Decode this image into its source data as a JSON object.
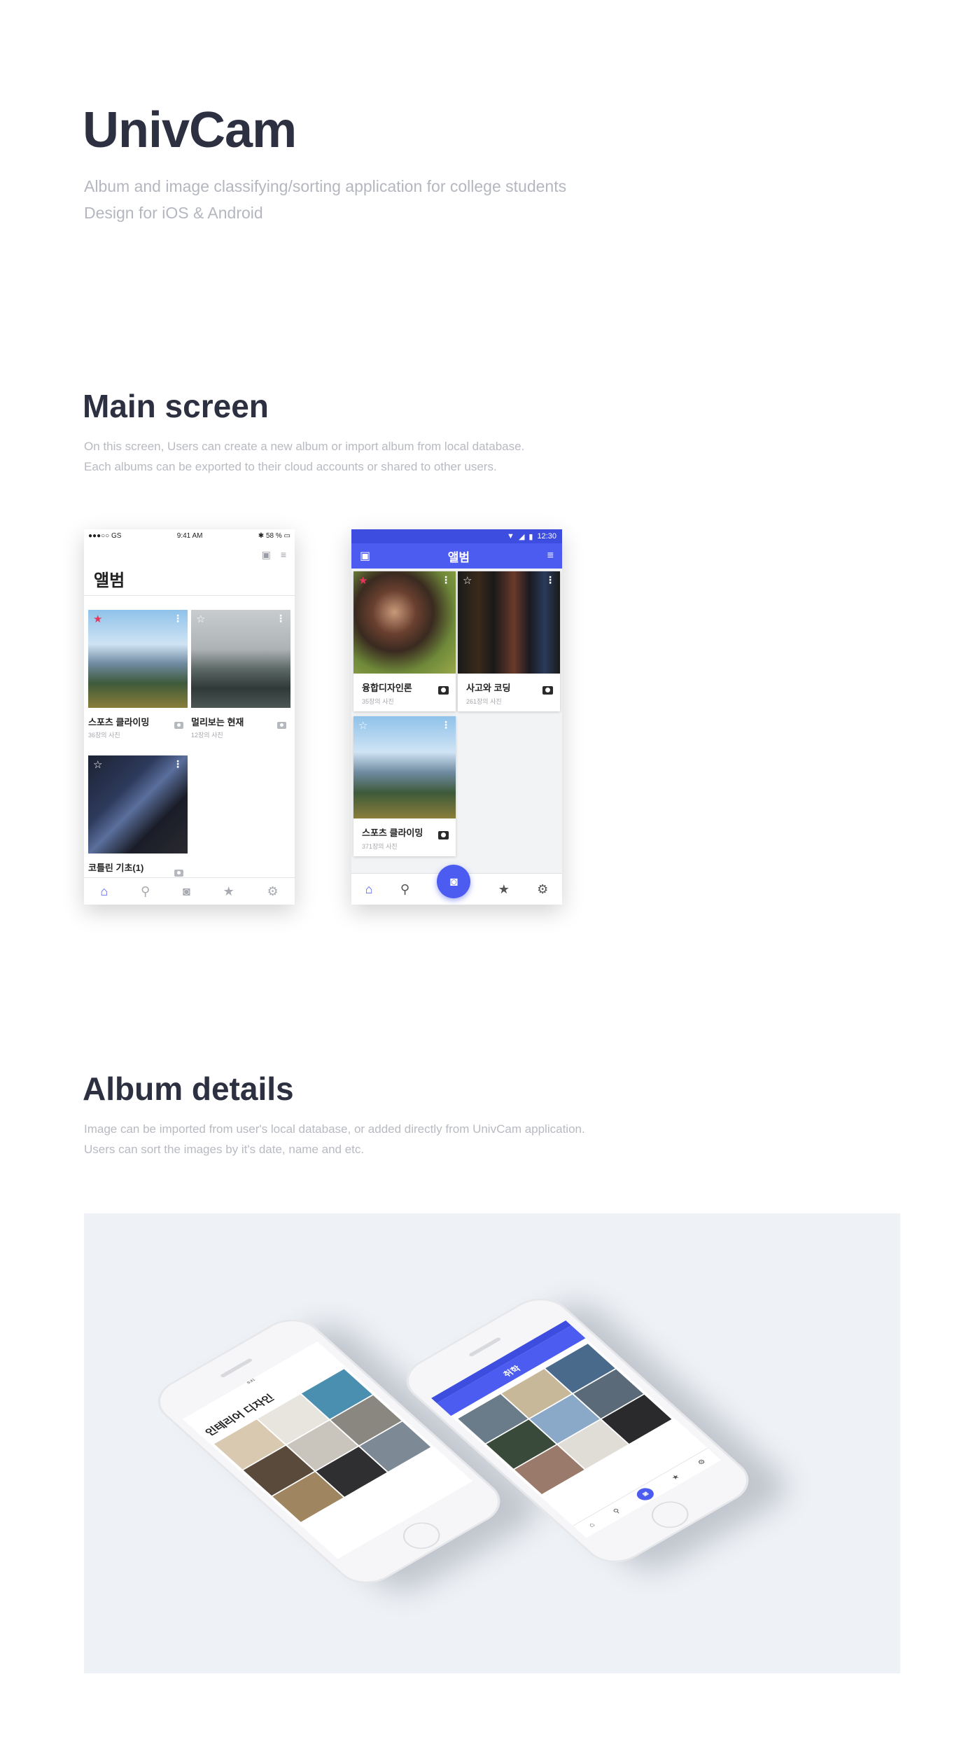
{
  "header": {
    "title": "UnivCam",
    "subtitle_line1": "Album and image classifying/sorting application for college students",
    "subtitle_line2": "Design for iOS & Android"
  },
  "main_section": {
    "title": "Main screen",
    "desc_line1": "On this screen, Users can create a new album or import album from local database.",
    "desc_line2": "Each albums can be exported to their cloud accounts or shared to other users."
  },
  "ios_screen": {
    "status_left": "●●●○○ GS",
    "status_time": "9:41 AM",
    "status_right": "58 %",
    "title": "앨범",
    "albums": [
      {
        "title": "스포츠 클라이밍",
        "count": "36장의 사진",
        "favorite": true
      },
      {
        "title": "멀리보는 현재",
        "count": "12장의 사진",
        "favorite": false
      },
      {
        "title": "코틀린 기초(1)",
        "count": "",
        "favorite": false
      }
    ],
    "tabs": [
      "home-icon",
      "search-icon",
      "camera-icon",
      "star-icon",
      "gear-icon"
    ]
  },
  "android_screen": {
    "status_time": "12:30",
    "title": "앨범",
    "albums": [
      {
        "title": "융합디자인론",
        "count": "35장의 사진",
        "favorite": true
      },
      {
        "title": "사고와 코딩",
        "count": "261장의 사진",
        "favorite": false
      },
      {
        "title": "스포츠 클라이밍",
        "count": "371장의 사진",
        "favorite": false
      }
    ],
    "tabs": [
      "home-icon",
      "search-icon",
      "camera-icon",
      "star-icon",
      "gear-icon"
    ]
  },
  "details_section": {
    "title": "Album details",
    "desc_line1": "Image can be imported from user's local database, or added directly from UnivCam application.",
    "desc_line2": "Users can sort the images by it's date, name and etc."
  },
  "mockup": {
    "ios_album_title": "인테리어 디자인",
    "android_album_title": "취학"
  },
  "colors": {
    "accent": "#4c5cf0",
    "heading": "#2c3040",
    "muted": "#b4b7bf",
    "favorite": "#e8355a",
    "panel_bg": "#eef1f5"
  }
}
